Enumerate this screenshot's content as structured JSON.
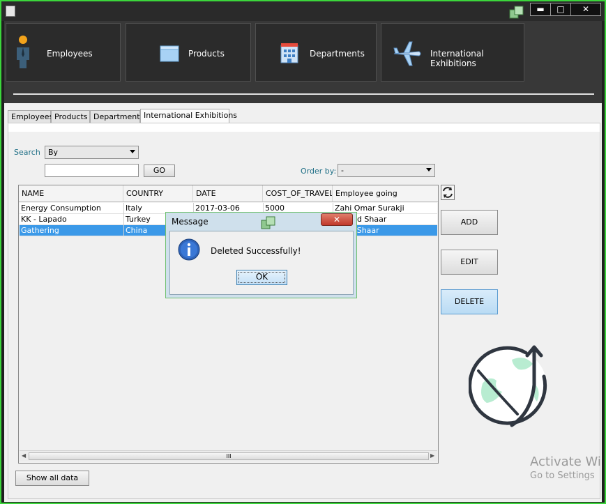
{
  "navbar": {
    "tiles": [
      {
        "label": "Employees",
        "icon": "person-icon"
      },
      {
        "label": "Products",
        "icon": "box-icon"
      },
      {
        "label": "Departments",
        "icon": "building-icon"
      },
      {
        "label": "International Exhibitions",
        "icon": "airplane-icon"
      }
    ]
  },
  "tabs": [
    {
      "label": "Employees",
      "active": false
    },
    {
      "label": "Products",
      "active": false
    },
    {
      "label": "Departments",
      "active": false
    },
    {
      "label": "International Exhibitions",
      "active": true
    }
  ],
  "search": {
    "label": "Search",
    "by_value": "By",
    "query": "",
    "go_label": "GO"
  },
  "order": {
    "label": "Order by:",
    "value": "-"
  },
  "table": {
    "columns": [
      "NAME",
      "COUNTRY",
      "DATE",
      "COST_OF_TRAVEL",
      "Employee going"
    ],
    "rows": [
      {
        "cells": [
          "Energy Consumption",
          "Italy",
          "2017-03-06",
          "5000",
          "Zahi Omar Surakji"
        ],
        "selected": false
      },
      {
        "cells": [
          "KK - Lapado",
          "Turkey",
          "",
          "",
          "Ahmad Shaar"
        ],
        "selected": false
      },
      {
        "cells": [
          "Gathering",
          "China",
          "",
          "",
          "Janar Shaar"
        ],
        "selected": true
      }
    ],
    "scroll_grip": "III"
  },
  "actions": {
    "add": "ADD",
    "edit": "EDIT",
    "delete": "DELETE"
  },
  "show_all": "Show all data",
  "watermark": {
    "line1": "Activate Wi",
    "line2": "Go to Settings"
  },
  "dialog": {
    "title": "Message",
    "message": "Deleted Successfully!",
    "ok": "OK"
  },
  "colors": {
    "accent": "#3b99e8",
    "teal_label": "#1f6f86",
    "globe_green": "#b8ecd1",
    "globe_stroke": "#2f3640"
  }
}
